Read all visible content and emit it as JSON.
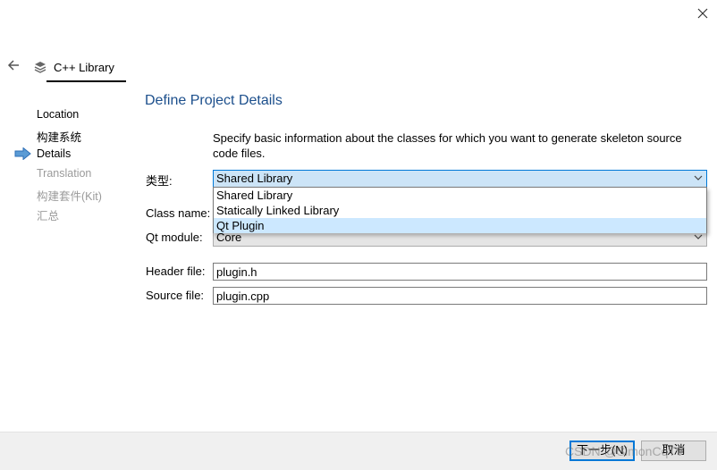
{
  "header": {
    "title": "C++ Library"
  },
  "sidebar": {
    "steps": [
      {
        "label": "Location",
        "state": "done"
      },
      {
        "label": "构建系统",
        "state": "done"
      },
      {
        "label": "Details",
        "state": "current"
      },
      {
        "label": "Translation",
        "state": "disabled"
      },
      {
        "label": "构建套件(Kit)",
        "state": "disabled"
      },
      {
        "label": "汇总",
        "state": "disabled"
      }
    ]
  },
  "main": {
    "title": "Define Project Details",
    "description": "Specify basic information about the classes for which you want to generate skeleton source code files.",
    "type": {
      "label": "类型:",
      "value": "Shared Library",
      "options": [
        "Shared Library",
        "Statically Linked Library",
        "Qt Plugin"
      ],
      "highlighted": "Qt Plugin"
    },
    "class_name": {
      "label": "Class name:"
    },
    "qt_module": {
      "label": "Qt module:",
      "value": "Core"
    },
    "header_file": {
      "label": "Header file:",
      "value": "plugin.h"
    },
    "source_file": {
      "label": "Source file:",
      "value": "plugin.cpp"
    }
  },
  "footer": {
    "next_label": "下一步(N)",
    "cancel_label": "取消"
  },
  "watermark": "CSDN @SimonCqTV",
  "colors": {
    "accent": "#0078d7",
    "title": "#1c4f8c",
    "highlight": "#cce8ff",
    "arrow": "#3a7bd5"
  }
}
